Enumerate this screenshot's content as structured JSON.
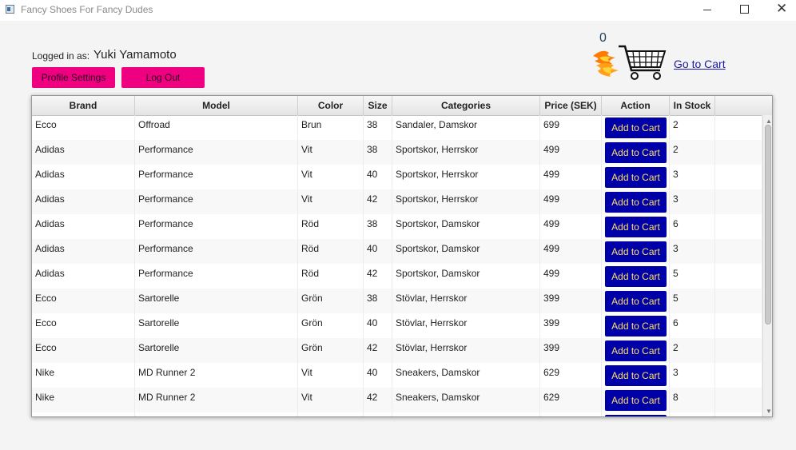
{
  "window": {
    "title": "Fancy Shoes For Fancy Dudes"
  },
  "user": {
    "label": "Logged in as:",
    "name": "Yuki Yamamoto"
  },
  "buttons": {
    "profile": "Profile Settings",
    "logout": "Log Out"
  },
  "cart": {
    "count": "0",
    "link": "Go to Cart"
  },
  "colors": {
    "pink_button": "#ef0081",
    "add_button": "#0000a8",
    "add_text": "#ffe066"
  },
  "table": {
    "headers": [
      "Brand",
      "Model",
      "Color",
      "Size",
      "Categories",
      "Price (SEK)",
      "Action",
      "In Stock"
    ],
    "action_label": "Add to Cart",
    "rows": [
      {
        "brand": "Ecco",
        "model": "Offroad",
        "color": "Brun",
        "size": "38",
        "categories": "Sandaler, Damskor",
        "price": "699",
        "stock": "2"
      },
      {
        "brand": "Adidas",
        "model": "Performance",
        "color": "Vit",
        "size": "38",
        "categories": "Sportskor, Herrskor",
        "price": "499",
        "stock": "2"
      },
      {
        "brand": "Adidas",
        "model": "Performance",
        "color": "Vit",
        "size": "40",
        "categories": "Sportskor, Herrskor",
        "price": "499",
        "stock": "3"
      },
      {
        "brand": "Adidas",
        "model": "Performance",
        "color": "Vit",
        "size": "42",
        "categories": "Sportskor, Herrskor",
        "price": "499",
        "stock": "3"
      },
      {
        "brand": "Adidas",
        "model": "Performance",
        "color": "Röd",
        "size": "38",
        "categories": "Sportskor, Damskor",
        "price": "499",
        "stock": "6"
      },
      {
        "brand": "Adidas",
        "model": "Performance",
        "color": "Röd",
        "size": "40",
        "categories": "Sportskor, Damskor",
        "price": "499",
        "stock": "3"
      },
      {
        "brand": "Adidas",
        "model": "Performance",
        "color": "Röd",
        "size": "42",
        "categories": "Sportskor, Damskor",
        "price": "499",
        "stock": "5"
      },
      {
        "brand": "Ecco",
        "model": "Sartorelle",
        "color": "Grön",
        "size": "38",
        "categories": "Stövlar, Herrskor",
        "price": "399",
        "stock": "5"
      },
      {
        "brand": "Ecco",
        "model": "Sartorelle",
        "color": "Grön",
        "size": "40",
        "categories": "Stövlar, Herrskor",
        "price": "399",
        "stock": "6"
      },
      {
        "brand": "Ecco",
        "model": "Sartorelle",
        "color": "Grön",
        "size": "42",
        "categories": "Stövlar, Herrskor",
        "price": "399",
        "stock": "2"
      },
      {
        "brand": "Nike",
        "model": "MD Runner 2",
        "color": "Vit",
        "size": "40",
        "categories": "Sneakers, Damskor",
        "price": "629",
        "stock": "3"
      },
      {
        "brand": "Nike",
        "model": "MD Runner 2",
        "color": "Vit",
        "size": "42",
        "categories": "Sneakers, Damskor",
        "price": "629",
        "stock": "8"
      }
    ]
  }
}
